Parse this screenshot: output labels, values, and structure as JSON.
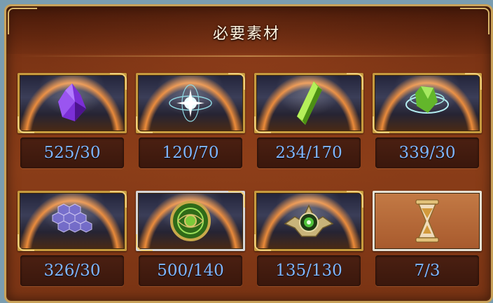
{
  "title": "必要素材",
  "materials": [
    {
      "icon": "purple-crystal-icon",
      "count": "525/30"
    },
    {
      "icon": "white-star-orb-icon",
      "count": "120/70"
    },
    {
      "icon": "green-crystal-shard-icon",
      "count": "234/170"
    },
    {
      "icon": "green-swirl-gem-icon",
      "count": "339/30"
    },
    {
      "icon": "hexagon-mesh-icon",
      "count": "326/30"
    },
    {
      "icon": "green-medallion-icon",
      "count": "500/140"
    },
    {
      "icon": "eye-emblem-icon",
      "count": "135/130"
    },
    {
      "icon": "hourglass-icon",
      "count": "7/3"
    }
  ],
  "colors": {
    "count_text": "#7fb6ff",
    "frame_gold": "#c79b3e",
    "panel": "#7d3515"
  }
}
